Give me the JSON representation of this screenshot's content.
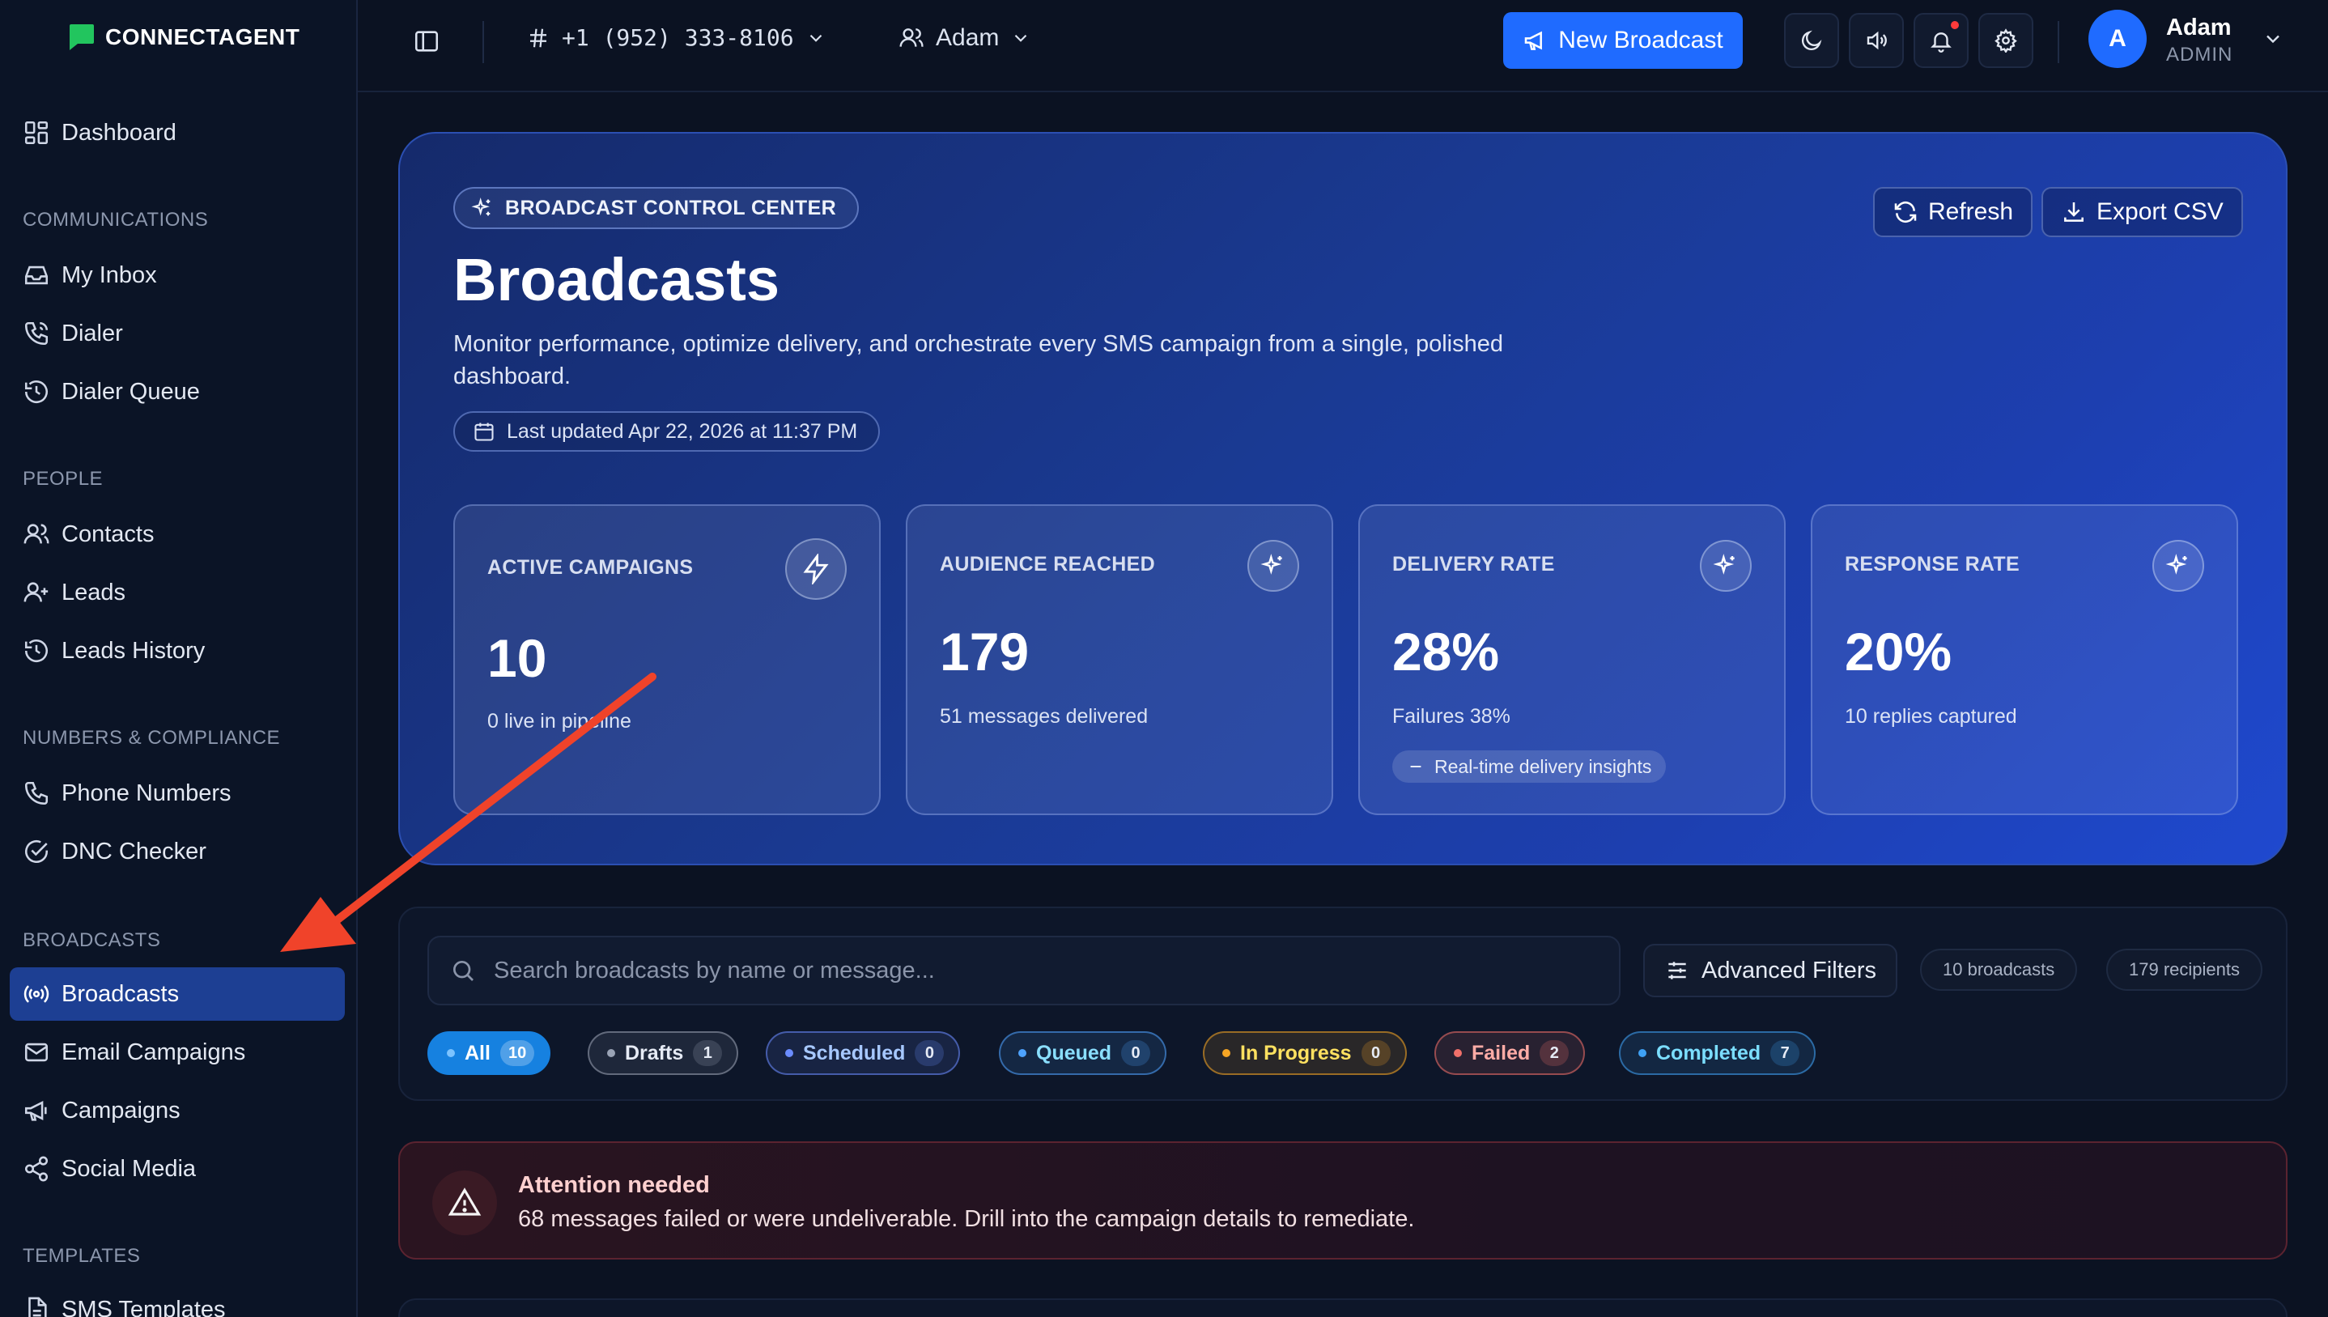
{
  "app": {
    "brand": "CONNECTAGENT",
    "brand_color": "#22c55e",
    "accent": "#1f6bff"
  },
  "sidebar": {
    "dashboard": "Dashboard",
    "sections": {
      "communications": "COMMUNICATIONS",
      "people": "PEOPLE",
      "numbers": "NUMBERS & COMPLIANCE",
      "broadcasts": "BROADCASTS",
      "templates": "TEMPLATES"
    },
    "items": {
      "my_inbox": "My Inbox",
      "dialer": "Dialer",
      "dialer_queue": "Dialer Queue",
      "contacts": "Contacts",
      "leads": "Leads",
      "leads_history": "Leads History",
      "phone_numbers": "Phone Numbers",
      "dnc_checker": "DNC Checker",
      "broadcasts": "Broadcasts",
      "email_campaigns": "Email Campaigns",
      "campaigns": "Campaigns",
      "social_media": "Social Media",
      "sms_templates": "SMS Templates"
    },
    "active_item": "broadcasts"
  },
  "topbar": {
    "phone_number": "+1 (952) 333-8106",
    "agent": "Adam",
    "new_broadcast": "New Broadcast",
    "user": {
      "initial": "A",
      "name": "Adam",
      "role": "ADMIN"
    }
  },
  "hero": {
    "tag": "BROADCAST CONTROL CENTER",
    "title": "Broadcasts",
    "description": "Monitor performance, optimize delivery, and orchestrate every SMS campaign from a single, polished dashboard.",
    "last_updated": "Last updated Apr 22, 2026 at 11:37 PM",
    "refresh": "Refresh",
    "export": "Export CSV"
  },
  "stats": [
    {
      "label": "ACTIVE CAMPAIGNS",
      "value": "10",
      "sub": "0 live in pipeline",
      "icon": "lightning-icon"
    },
    {
      "label": "AUDIENCE REACHED",
      "value": "179",
      "sub": "51 messages delivered",
      "icon": "sparkles-icon"
    },
    {
      "label": "DELIVERY RATE",
      "value": "28%",
      "sub": "Failures 38%",
      "badge": "Real-time delivery insights",
      "icon": "sparkles-icon"
    },
    {
      "label": "RESPONSE RATE",
      "value": "20%",
      "sub": "10 replies captured",
      "icon": "sparkles-icon"
    }
  ],
  "filters": {
    "search_placeholder": "Search broadcasts by name or message...",
    "advanced": "Advanced Filters",
    "total_broadcasts": "10 broadcasts",
    "total_recipients": "179 recipients",
    "chips": [
      {
        "label": "All",
        "count": "10",
        "color": "#1e8ef0",
        "active": true
      },
      {
        "label": "Drafts",
        "count": "1",
        "color": "#9aa3b5",
        "active": false
      },
      {
        "label": "Scheduled",
        "count": "0",
        "color": "#6b8cff",
        "active": false
      },
      {
        "label": "Queued",
        "count": "0",
        "color": "#4ea3ff",
        "active": false
      },
      {
        "label": "In Progress",
        "count": "0",
        "color": "#f5a524",
        "active": false
      },
      {
        "label": "Failed",
        "count": "2",
        "color": "#f0706a",
        "active": false
      },
      {
        "label": "Completed",
        "count": "7",
        "color": "#3fa2f5",
        "active": false
      }
    ]
  },
  "alert": {
    "title": "Attention needed",
    "message": "68 messages failed or were undeliverable. Drill into the campaign details to remediate.",
    "color": "#f0706a"
  }
}
